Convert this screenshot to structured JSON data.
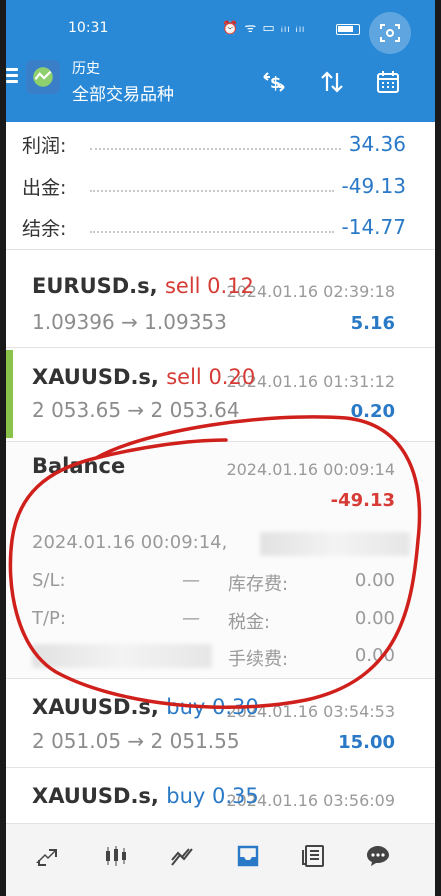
{
  "status": {
    "time": "10:31",
    "icons": "⏰ ᯤ ▭ ᵢₗₗ ᵢₗₗ"
  },
  "header": {
    "title": "历史",
    "subtitle": "全部交易品种"
  },
  "toolbar": {
    "currency_icon": "currency-dollar-swap-icon",
    "sort_icon": "sort-arrows-icon",
    "calendar_icon": "calendar-icon"
  },
  "summary": [
    {
      "label": "利润:",
      "value": "34.36"
    },
    {
      "label": "出金:",
      "value": "-49.13"
    },
    {
      "label": "结余:",
      "value": "-14.77"
    }
  ],
  "deals": [
    {
      "symbol": "EURUSD.s,",
      "direction": "sell 0.12",
      "time": "2024.01.16 02:39:18",
      "prices": "1.09396 → 1.09353",
      "profit": "5.16"
    },
    {
      "symbol": "XAUUSD.s,",
      "direction": "sell 0.20",
      "time": "2024.01.16 01:31:12",
      "prices": "2 053.65 → 2 053.64",
      "profit": "0.20"
    },
    {
      "symbol": "XAUUSD.s,",
      "direction": "buy 0.30",
      "time": "2024.01.16 03:54:53",
      "prices": "2 051.05 → 2 051.55",
      "profit": "15.00"
    },
    {
      "symbol": "XAUUSD.s,",
      "direction": "buy 0.35",
      "time": "2024.01.16 03:56:09",
      "prices": "",
      "profit": ""
    }
  ],
  "balance": {
    "title": "Balance",
    "time": "2024.01.16 00:09:14",
    "amount": "-49.13",
    "detail_time": "2024.01.16 00:09:14,",
    "sl_label": "S/L:",
    "sl_value": "—",
    "tp_label": "T/P:",
    "tp_value": "—",
    "swap_label": "库存费:",
    "swap_value": "0.00",
    "tax_label": "税金:",
    "tax_value": "0.00",
    "fee_label": "手续费:",
    "fee_value": "0.00"
  },
  "colors": {
    "header_bg": "#2a89d6",
    "accent_blue": "#2a79c6",
    "sell_red": "#d63b35",
    "open_green": "#8bc34a",
    "annotation_red": "#d0201c"
  },
  "bottom_nav": [
    "trade-icon",
    "chart-candles-icon",
    "trend-icon",
    "history-inbox-icon",
    "news-icon",
    "chat-icon"
  ]
}
